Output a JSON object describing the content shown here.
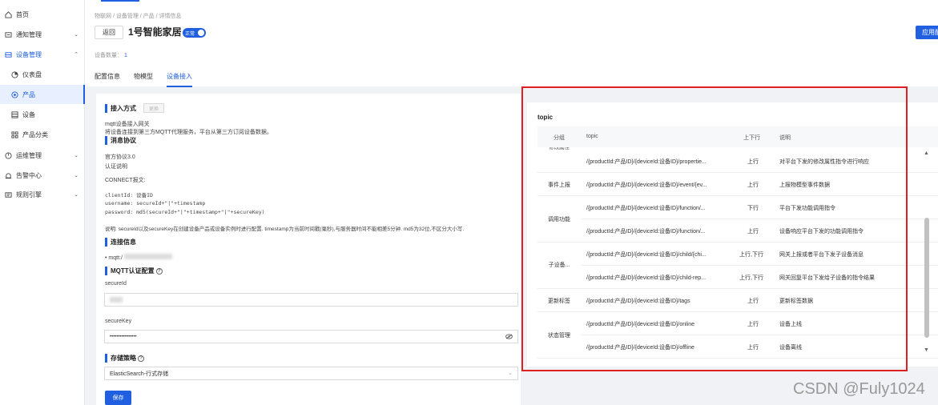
{
  "sidebar": {
    "items": [
      {
        "label": "首页",
        "icon": "home-icon"
      },
      {
        "label": "通知管理",
        "icon": "notification-icon"
      },
      {
        "label": "设备管理",
        "icon": "device-icon"
      },
      {
        "label": "仪表盘",
        "icon": "dashboard-icon"
      },
      {
        "label": "产品",
        "icon": "product-icon"
      },
      {
        "label": "设备",
        "icon": "device-list-icon"
      },
      {
        "label": "产品分类",
        "icon": "category-icon"
      },
      {
        "label": "运维管理",
        "icon": "ops-icon"
      },
      {
        "label": "告警中心",
        "icon": "alarm-icon"
      },
      {
        "label": "规则引擎",
        "icon": "rule-icon"
      }
    ]
  },
  "header": {
    "breadcrumb": "物联网 / 设备管理 / 产品 / 详情信息",
    "back_label": "返回",
    "title": "1号智能家居",
    "status_label": "正常",
    "apply_label": "应用配置",
    "device_count_label": "设备数量：",
    "device_count": "1",
    "tabs": [
      "配置信息",
      "物模型",
      "设备接入"
    ]
  },
  "content": {
    "access_title": "接入方式",
    "edit_label": "更换",
    "access_name": "mqtt设备接入网关",
    "access_desc": "将设备连接到第三方MQTT代理服务，平台从第三方订阅设备数据。",
    "protocol_title": "消息协议",
    "protocol_name": "官方协议3.0",
    "auth_title": "认证说明",
    "connect_label": "CONNECT报文:",
    "code1": "clientId: 设备ID",
    "code2": "username: secureId+\"|\"+timestamp",
    "code3": "password: md5(secureId+\"|\"+timestamp+\"|\"+secureKey)",
    "note": "说明: secureId以及secureKey在创建设备产品或设备实例时进行配置. timestamp为当前时间戳(毫秒),与服务器时间不能相差5分钟. md5为32位,不区分大小写.",
    "conn_title": "连接信息",
    "conn_value": "mqtt:/",
    "mqtt_auth_title": "MQTT认证配置",
    "secure_id_label": "secureId",
    "secure_key_label": "secureKey",
    "secure_key_value": "••••••••••••••••",
    "storage_title": "存储策略",
    "storage_value": "ElasticSearch-行式存储",
    "save_label": "保存"
  },
  "topic_panel": {
    "title": "topic",
    "headers": [
      "分组",
      "topic",
      "上下行",
      "说明"
    ],
    "groups": [
      {
        "name": "修改属性"
      },
      {
        "name": "事件上报"
      },
      {
        "name": "调用功能"
      },
      {
        "name": "子设备..."
      },
      {
        "name": "更新标签"
      },
      {
        "name": "状态管理"
      }
    ],
    "rows": [
      {
        "topic": "/{productId:产品ID}/{deviceId:设备ID}/propertie...",
        "dir": "上行",
        "desc": "对平台下发的修改属性指令进行响应"
      },
      {
        "topic": "/{productId:产品ID}/{deviceId:设备ID}/event/{ev...",
        "dir": "上行",
        "desc": "上报物模型事件数据"
      },
      {
        "topic": "/{productId:产品ID}/{deviceId:设备ID}/function/...",
        "dir": "下行",
        "desc": "平台下发功能调用指令"
      },
      {
        "topic": "/{productId:产品ID}/{deviceId:设备ID}/function/...",
        "dir": "上行",
        "desc": "设备响应平台下发的功能调用指令"
      },
      {
        "topic": "/{productId:产品ID}/{deviceId:设备ID}/child/{chi...",
        "dir": "上行,下行",
        "desc": "网关上报或者平台下发子设备消息"
      },
      {
        "topic": "/{productId:产品ID}/{deviceId:设备ID}/child-rep...",
        "dir": "上行,下行",
        "desc": "网关回复平台下发给子设备的指令结果"
      },
      {
        "topic": "/{productId:产品ID}/{deviceId:设备ID}/tags",
        "dir": "上行",
        "desc": "更新标签数据"
      },
      {
        "topic": "/{productId:产品ID}/{deviceId:设备ID}/online",
        "dir": "上行",
        "desc": "设备上线"
      },
      {
        "topic": "/{productId:产品ID}/{deviceId:设备ID}/offline",
        "dir": "上行",
        "desc": "设备离线"
      }
    ]
  },
  "watermark": "CSDN @Fuly1024",
  "colors": {
    "accent": "#1f5fe0",
    "highlight": "#e02020"
  }
}
